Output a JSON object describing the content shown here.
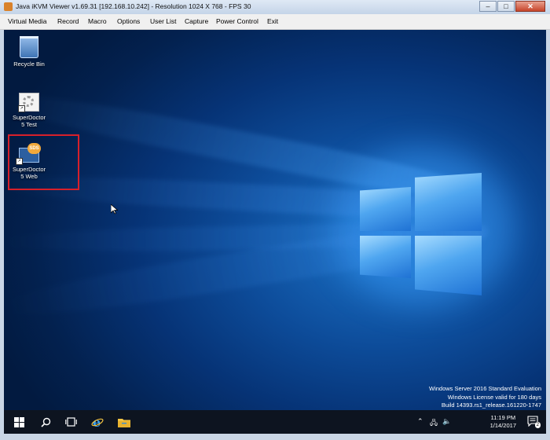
{
  "window": {
    "title": "Java iKVM Viewer v1.69.31 [192.168.10.242]  - Resolution 1024 X 768 - FPS 30",
    "min_label": "–",
    "max_label": "□",
    "close_label": "✕"
  },
  "menu": {
    "items": [
      "Virtual Media",
      "Record",
      "Macro",
      "Options",
      "User List",
      "Capture",
      "Power Control",
      "Exit"
    ]
  },
  "desktop": {
    "icons": [
      {
        "label_1": "Recycle Bin",
        "label_2": "",
        "icon": "recycle-bin-icon"
      },
      {
        "label_1": "SuperDoctor",
        "label_2": "5 Test",
        "icon": "superdoctor-test-icon"
      },
      {
        "label_1": "SuperDoctor",
        "label_2": "5 Web",
        "icon": "superdoctor-web-icon",
        "badge": "SDS",
        "highlighted": true
      }
    ],
    "watermark": [
      "Windows Server 2016 Standard Evaluation",
      "Windows License valid for 180 days",
      "Build 14393.rs1_release.161220-1747"
    ],
    "highlight_color": "#d8202a"
  },
  "taskbar": {
    "items": [
      "windows-start-icon",
      "search-icon",
      "task-view-icon",
      "internet-explorer-icon",
      "file-explorer-icon"
    ],
    "tray": {
      "time": "11:19 PM",
      "date": "1/14/2017",
      "notification_count": "2"
    }
  },
  "colors": {
    "accent_blue": "#1c73c8",
    "taskbar": "#0d1420"
  }
}
